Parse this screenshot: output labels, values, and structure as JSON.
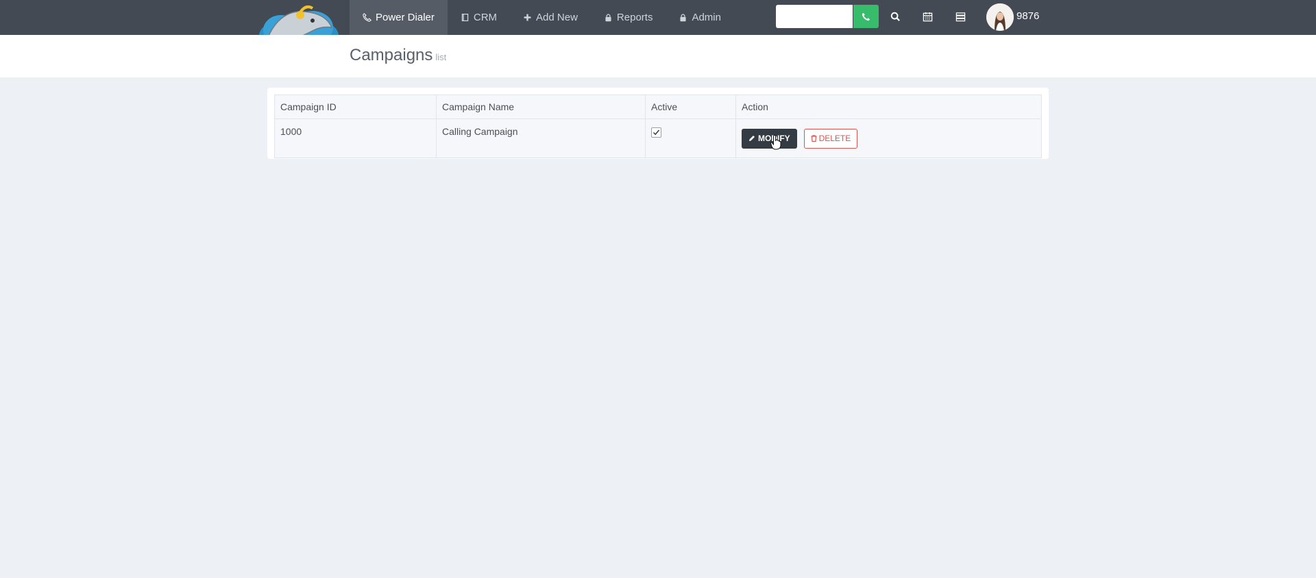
{
  "nav": {
    "items": [
      {
        "label": "Power Dialer",
        "icon": "phone-icon"
      },
      {
        "label": "CRM",
        "icon": "book-icon"
      },
      {
        "label": "Add New",
        "icon": "plus-icon"
      },
      {
        "label": "Reports",
        "icon": "lock-icon"
      },
      {
        "label": "Admin",
        "icon": "lock-icon"
      }
    ],
    "active": "Power Dialer"
  },
  "search": {
    "value": "",
    "placeholder": ""
  },
  "user": {
    "extension": "9876"
  },
  "page": {
    "title": "Campaigns",
    "subtitle": "list"
  },
  "table": {
    "headers": [
      "Campaign ID",
      "Campaign Name",
      "Active",
      "Action"
    ],
    "rows": [
      {
        "id": "1000",
        "name": "Calling Campaign",
        "active": true
      }
    ],
    "actions": {
      "modify": "MODIFY",
      "delete": "DELETE"
    }
  },
  "colors": {
    "topbar": "#434a54",
    "call_button": "#37bc6b",
    "modify_button": "#353b42",
    "delete_button": "#d9534f"
  }
}
